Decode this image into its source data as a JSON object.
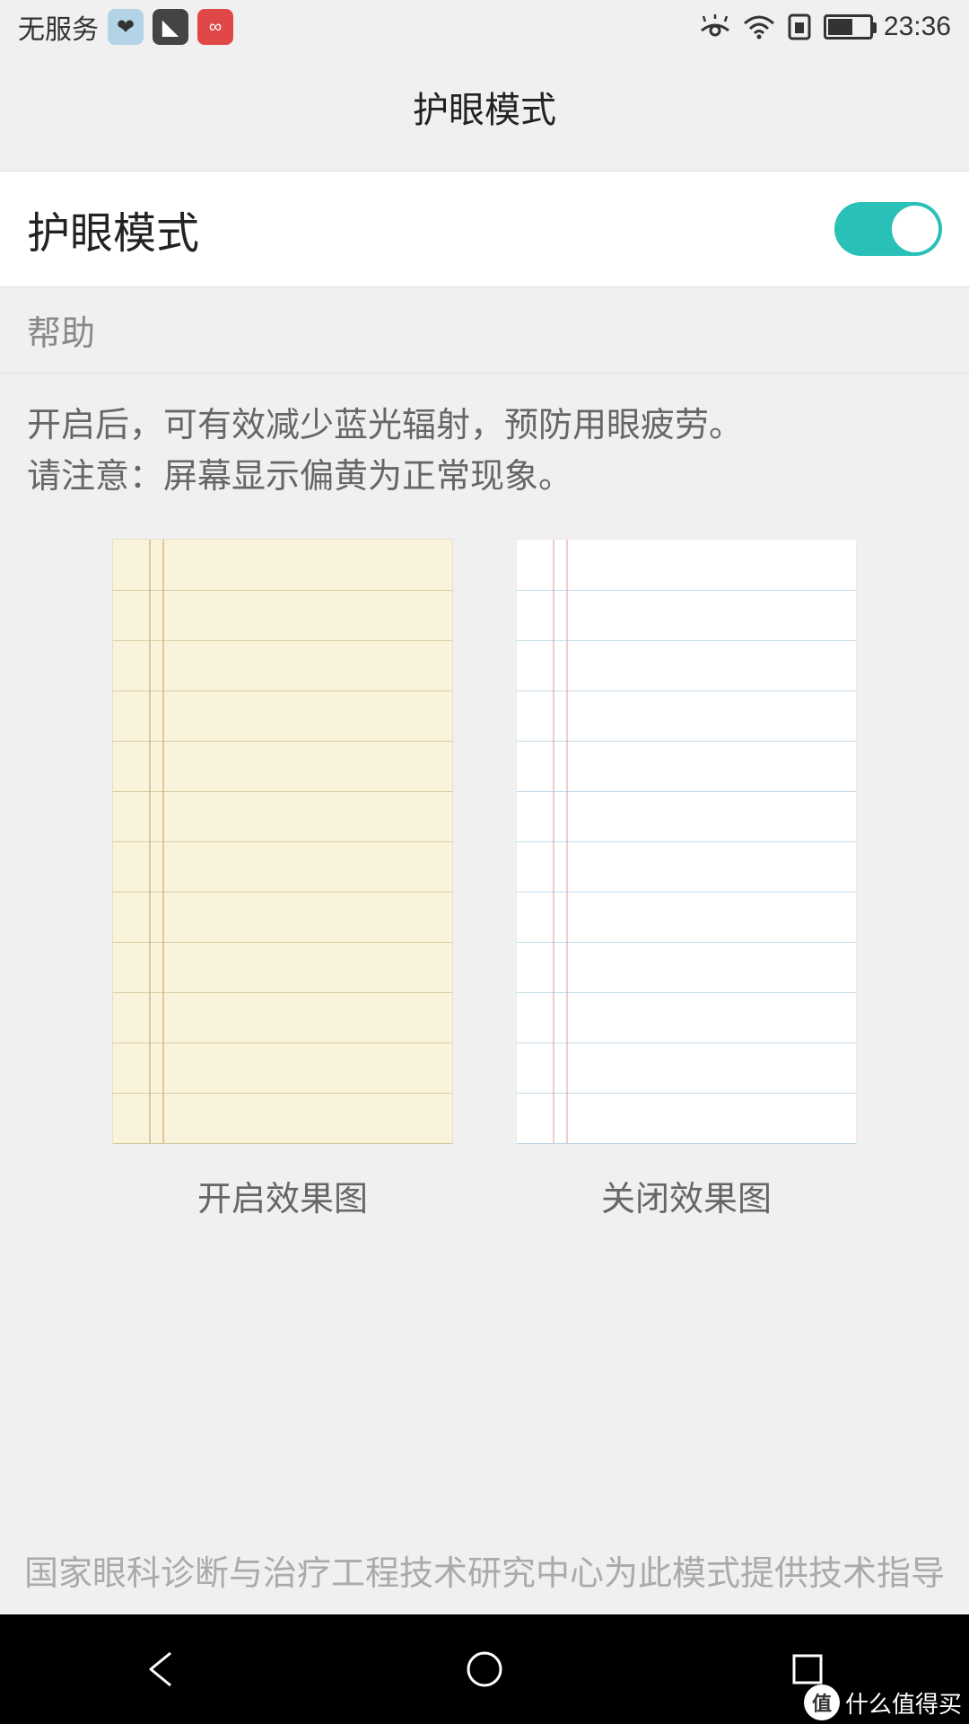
{
  "status_bar": {
    "carrier": "无服务",
    "time": "23:36"
  },
  "page_title": "护眼模式",
  "toggle": {
    "label": "护眼模式",
    "on": true
  },
  "section_header": "帮助",
  "help_text_line1": "开启后，可有效减少蓝光辐射，预防用眼疲劳。",
  "help_text_line2": "请注意：屏幕显示偏黄为正常现象。",
  "preview_on_caption": "开启效果图",
  "preview_off_caption": "关闭效果图",
  "footer": "国家眼科诊断与治疗工程技术研究中心为此模式提供技术指导",
  "watermark": {
    "badge": "值",
    "text": "什么值得买"
  }
}
